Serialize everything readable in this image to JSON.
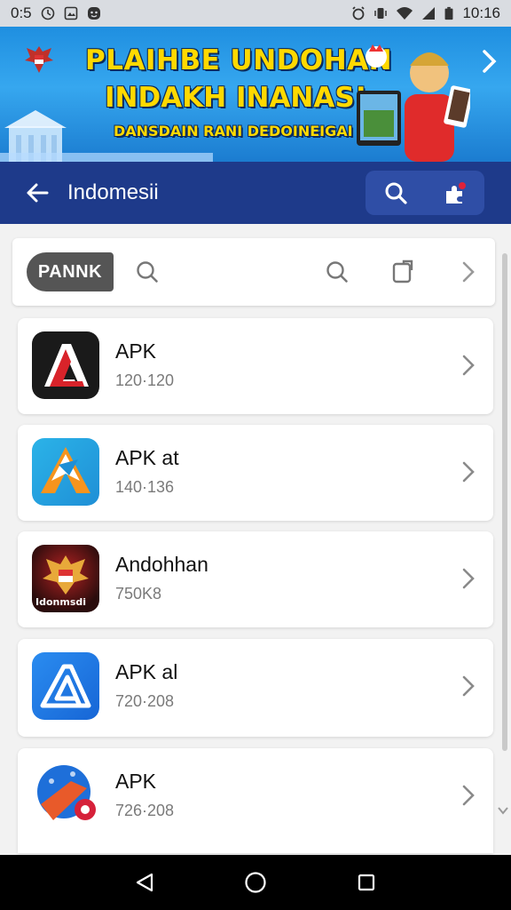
{
  "status_bar": {
    "left_text": "0:5",
    "time": "10:16",
    "icons": [
      "clock-icon",
      "photo-icon",
      "emoji-icon",
      "alarm-icon",
      "vibrate-icon",
      "wifi-icon",
      "signal-icon",
      "battery-icon"
    ]
  },
  "banner": {
    "line1": "PLAIHBE UNDOHAN",
    "line2": "INDAKH INANAS!",
    "line3": "DANSDAIN RANI DEDOINEIGAI"
  },
  "app_bar": {
    "title": "Indomesii",
    "color": "#1e3a8a"
  },
  "filter": {
    "chip_label": "PANNK"
  },
  "apps": [
    {
      "name": "APK",
      "meta": "120·120",
      "icon": "red-a-logo-icon"
    },
    {
      "name": "APK at",
      "meta": "140·136",
      "icon": "blue-orange-arrow-logo-icon"
    },
    {
      "name": "Andohhan",
      "meta": "750K8",
      "icon": "garuda-logo-icon",
      "icon_text": "Idonmsdi"
    },
    {
      "name": "APK al",
      "meta": "720·208",
      "icon": "blue-a-logo-icon"
    },
    {
      "name": "APK",
      "meta": "726·208",
      "icon": "ball-flag-logo-icon"
    }
  ],
  "nav": [
    "back-nav-icon",
    "home-nav-icon",
    "recents-nav-icon"
  ]
}
